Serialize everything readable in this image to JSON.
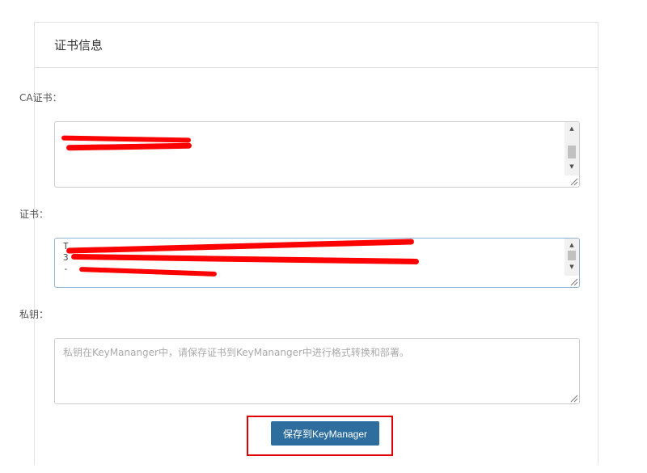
{
  "panel": {
    "title": "证书信息"
  },
  "fields": {
    "ca_cert": {
      "label": "CA证书：",
      "visible_text": ""
    },
    "cert": {
      "label": "证书：",
      "visible_text": "T\n3\n-"
    },
    "private_key": {
      "label": "私钥：",
      "placeholder": "私钥在KeyMananger中，请保存证书到KeyMananger中进行格式转换和部署。"
    }
  },
  "actions": {
    "save_label": "保存到KeyManager"
  },
  "colors": {
    "primary_button": "#2e6e9e",
    "highlight_box": "#e00000",
    "redaction": "#ff0000",
    "border": "#cccccc"
  }
}
